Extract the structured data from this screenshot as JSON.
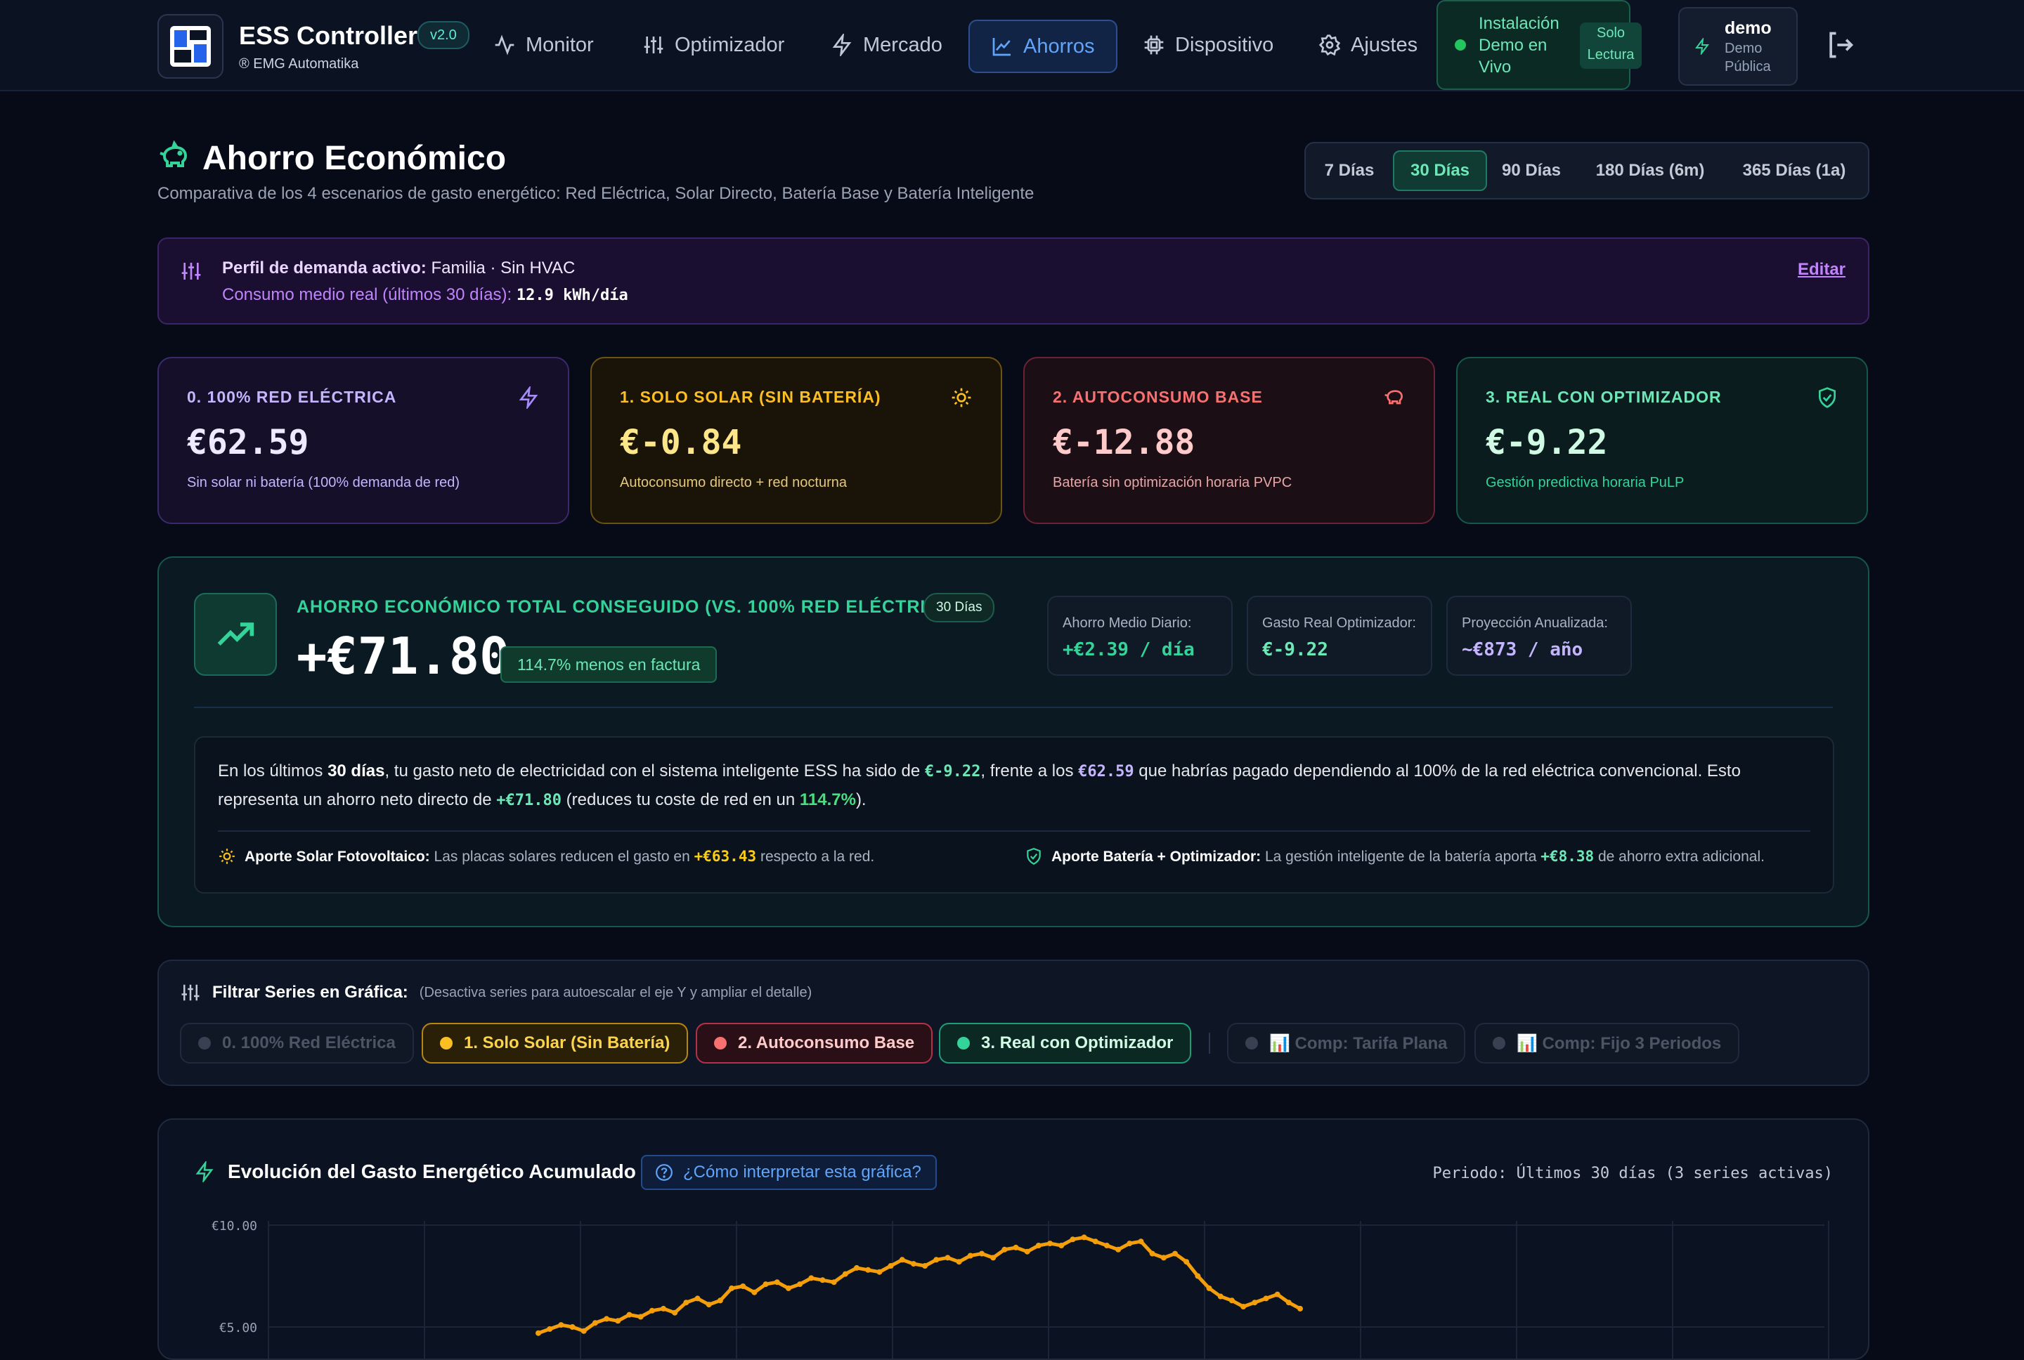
{
  "app": {
    "title": "ESS Controller",
    "version": "v2.0",
    "company": "® EMG Automatika"
  },
  "nav": {
    "items": [
      {
        "label": "Monitor",
        "icon": "activity-icon"
      },
      {
        "label": "Optimizador",
        "icon": "sliders-icon"
      },
      {
        "label": "Mercado",
        "icon": "lightning-icon"
      },
      {
        "label": "Ahorros",
        "icon": "chart-line-icon",
        "active": true
      },
      {
        "label": "Dispositivo",
        "icon": "chip-icon"
      },
      {
        "label": "Ajustes",
        "icon": "gear-icon"
      }
    ],
    "demo_status": "Instalación Demo en Vivo",
    "demo_badge": "Solo Lectura",
    "user_name": "demo",
    "user_role": "Demo Pública"
  },
  "header": {
    "title": "Ahorro Económico",
    "subtitle": "Comparativa de los 4 escenarios de gasto energético: Red Eléctrica, Solar Directo, Batería Base y Batería Inteligente",
    "ranges": [
      "7 Días",
      "30 Días",
      "90 Días",
      "180 Días (6m)",
      "365 Días (1a)"
    ],
    "active_range": "30 Días"
  },
  "profile": {
    "label": "Perfil de demanda activo:",
    "value": "Familia · Sin HVAC",
    "consumo_label": "Consumo medio real (últimos 30 días):",
    "consumo_value": "12.9 kWh/día",
    "edit": "Editar"
  },
  "cards": [
    {
      "title": "0. 100% RED ELÉCTRICA",
      "value": "€62.59",
      "desc": "Sin solar ni batería (100% demanda de red)",
      "color": "#a78bfa",
      "icon": "lightning-icon"
    },
    {
      "title": "1. SOLO SOLAR (SIN BATERÍA)",
      "value": "€-0.84",
      "desc": "Autoconsumo directo + red nocturna",
      "color": "#fbbf24",
      "icon": "sun-icon"
    },
    {
      "title": "2. AUTOCONSUMO BASE",
      "value": "€-12.88",
      "desc": "Batería sin optimización horaria PVPC",
      "color": "#f87171",
      "icon": "piggy-bank-icon"
    },
    {
      "title": "3. REAL CON OPTIMIZADOR",
      "value": "€-9.22",
      "desc": "Gestión predictiva horaria PuLP",
      "color": "#34d399",
      "icon": "shield-icon"
    }
  ],
  "savings": {
    "label": "AHORRO ECONÓMICO TOTAL CONSEGUIDO (VS. 100% RED ELÉCTRICA)",
    "period": "30 Días",
    "total": "+€71.80",
    "pct": "114.7% menos en factura",
    "stats": [
      {
        "label": "Ahorro Medio Diario:",
        "value": "+€2.39 / día",
        "color": "#34d399"
      },
      {
        "label": "Gasto Real Optimizador:",
        "value": "€-9.22",
        "color": "#6ee7b7"
      },
      {
        "label": "Proyección Anualizada:",
        "value": "~€873 / año",
        "color": "#c4b5fd"
      }
    ],
    "explain": {
      "t1": "En los últimos ",
      "days": "30 días",
      "t2": ", tu gasto neto de electricidad con el sistema inteligente ESS ha sido de ",
      "real": "€-9.22",
      "t3": ", frente a los ",
      "grid": "€62.59",
      "t4": " que habrías pagado dependiendo al 100% de la red eléctrica convencional. Esto representa un ahorro neto directo de ",
      "saving": "+€71.80",
      "t5": " (reduces tu coste de red en un ",
      "pct": "114.7%",
      "t6": ")."
    },
    "solar": {
      "label": "Aporte Solar Fotovoltaico:",
      "t1": "Las placas solares reducen el gasto en ",
      "value": "+€63.43",
      "t2": " respecto a la red."
    },
    "battery": {
      "label": "Aporte Batería + Optimizador:",
      "t1": "La gestión inteligente de la batería aporta ",
      "value": "+€8.38",
      "t2": " de ahorro extra adicional."
    }
  },
  "filters": {
    "title": "Filtrar Series en Gráfica:",
    "hint": "(Desactiva series para autoescalar el eje Y y ampliar el detalle)",
    "chips": [
      {
        "label": "0. 100% Red Eléctrica",
        "active": false,
        "color": "#475569"
      },
      {
        "label": "1. Solo Solar (Sin Batería)",
        "active": true,
        "color": "#fbbf24"
      },
      {
        "label": "2. Autoconsumo Base",
        "active": true,
        "color": "#f87171"
      },
      {
        "label": "3. Real con Optimizador",
        "active": true,
        "color": "#34d399"
      },
      {
        "label": "📊 Comp: Tarifa Plana",
        "active": false,
        "color": "#475569"
      },
      {
        "label": "📊 Comp: Fijo 3 Periodos",
        "active": false,
        "color": "#475569"
      }
    ]
  },
  "chart": {
    "title": "Evolución del Gasto Energético Acumulado",
    "help": "¿Cómo interpretar esta gráfica?",
    "period": "Periodo: Últimos 30 días (3 series activas)"
  },
  "chart_data": {
    "type": "line",
    "yticks": [
      "€10.00",
      "€5.00"
    ],
    "ylim": [
      0,
      10
    ],
    "grid": true,
    "series": [
      {
        "name": "1. Solo Solar (Sin Batería)",
        "color": "#f59e0b",
        "x": [
          0,
          1,
          2,
          3,
          4,
          5,
          6,
          7,
          8,
          9,
          10,
          11,
          12,
          13,
          14,
          15,
          16,
          17,
          18,
          19,
          20,
          21,
          22,
          23,
          24,
          25,
          26,
          27,
          28,
          29,
          30,
          31,
          32,
          33,
          34,
          35,
          36,
          37,
          38,
          39,
          40,
          41,
          42,
          43,
          44,
          45,
          46,
          47,
          48,
          49,
          50,
          51,
          52,
          53,
          54,
          55,
          56,
          57,
          58,
          59,
          60,
          61,
          62,
          63,
          64,
          65,
          66,
          67
        ],
        "values": [
          4.7,
          4.9,
          5.1,
          5.0,
          4.8,
          5.2,
          5.4,
          5.3,
          5.6,
          5.5,
          5.8,
          5.9,
          5.7,
          6.2,
          6.4,
          6.1,
          6.3,
          6.9,
          7.0,
          6.7,
          7.1,
          7.2,
          6.9,
          7.1,
          7.4,
          7.3,
          7.2,
          7.6,
          7.9,
          7.8,
          7.7,
          8.0,
          8.3,
          8.1,
          8.0,
          8.3,
          8.4,
          8.2,
          8.5,
          8.6,
          8.4,
          8.8,
          8.9,
          8.7,
          9.0,
          9.1,
          9.0,
          9.3,
          9.4,
          9.2,
          9.0,
          8.8,
          9.1,
          9.2,
          8.6,
          8.4,
          8.6,
          8.2,
          7.5,
          6.9,
          6.5,
          6.3,
          6.0,
          6.2,
          6.4,
          6.6,
          6.2,
          5.9
        ]
      }
    ]
  }
}
